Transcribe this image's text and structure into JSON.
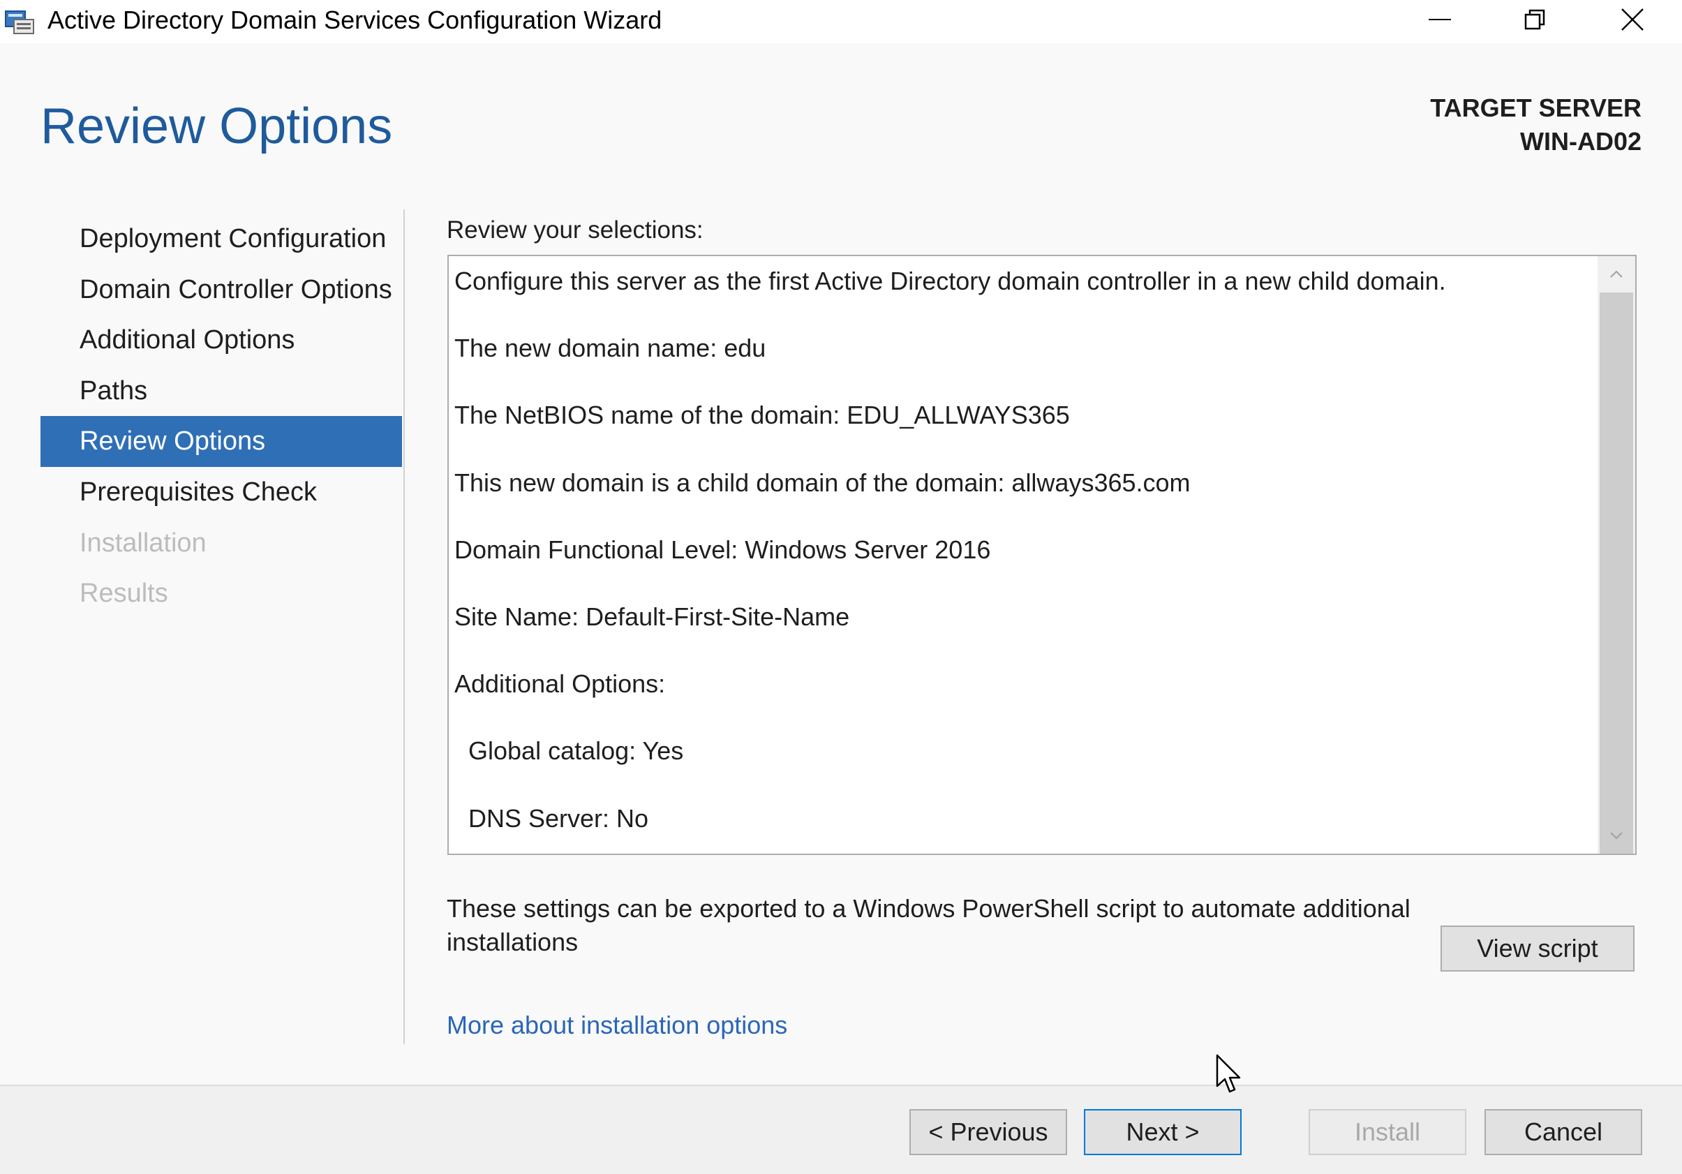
{
  "window": {
    "title": "Active Directory Domain Services Configuration Wizard",
    "controls": [
      "minimize-icon",
      "restore-icon",
      "close-icon"
    ]
  },
  "header": {
    "page_title": "Review Options",
    "target_server_label": "TARGET SERVER",
    "target_server_name": "WIN-AD02"
  },
  "nav": {
    "items": [
      {
        "label": "Deployment Configuration",
        "state": "normal"
      },
      {
        "label": "Domain Controller Options",
        "state": "normal"
      },
      {
        "label": "Additional Options",
        "state": "normal"
      },
      {
        "label": "Paths",
        "state": "normal"
      },
      {
        "label": "Review Options",
        "state": "active"
      },
      {
        "label": "Prerequisites Check",
        "state": "normal"
      },
      {
        "label": "Installation",
        "state": "disabled"
      },
      {
        "label": "Results",
        "state": "disabled"
      }
    ]
  },
  "review": {
    "label": "Review your selections:",
    "lines": [
      "Configure this server as the first Active Directory domain controller in a new child domain.",
      "The new domain name: edu",
      "The NetBIOS name of the domain: EDU_ALLWAYS365",
      "This new domain is a child domain of the domain: allways365.com",
      "Domain Functional Level: Windows Server 2016",
      "Site Name: Default-First-Site-Name",
      "Additional Options:",
      "Global catalog: Yes",
      "DNS Server: No"
    ]
  },
  "export": {
    "text": "These settings can be exported to a Windows PowerShell script to automate additional installations",
    "view_script_label": "View script"
  },
  "more_link": "More about installation options",
  "footer": {
    "previous_label": "< Previous",
    "next_label": "Next >",
    "install_label": "Install",
    "cancel_label": "Cancel"
  },
  "colors": {
    "accent": "#2f6fb6",
    "title_blue": "#1e5b9c",
    "link_blue": "#2a66b8",
    "focus_border": "#0078d7"
  }
}
